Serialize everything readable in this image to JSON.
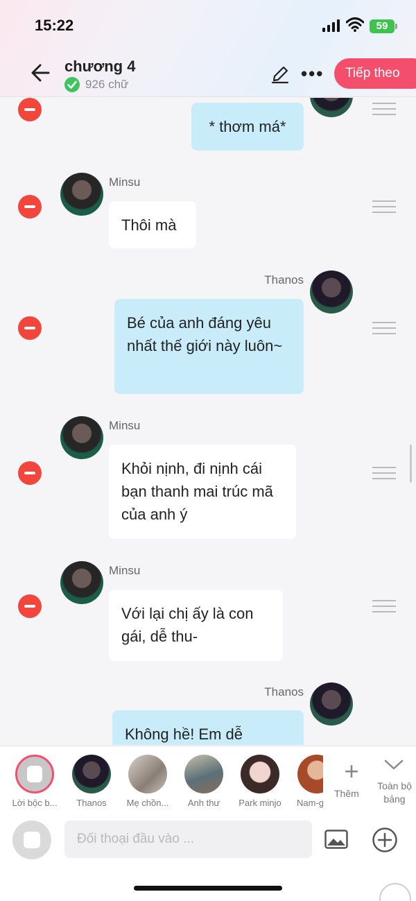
{
  "status": {
    "time": "15:22",
    "battery": "59"
  },
  "header": {
    "title": "chương 4",
    "word_count": "926 chữ",
    "next_label": "Tiếp theo"
  },
  "messages": [
    {
      "side": "right",
      "sender": "",
      "text": "* thơm má*"
    },
    {
      "side": "left",
      "sender": "Minsu",
      "text": "Thôi mà"
    },
    {
      "side": "right",
      "sender": "Thanos",
      "text": "Bé của anh đáng yêu nhất thế giới này luôn~"
    },
    {
      "side": "left",
      "sender": "Minsu",
      "text": "Khỏi nịnh, đi nịnh cái bạn thanh mai trúc mã của anh ý"
    },
    {
      "side": "left",
      "sender": "Minsu",
      "text": "Với lại chị ấy là con gái, dễ thu-"
    },
    {
      "side": "right",
      "sender": "Thanos",
      "text": "Không hề! Em dễ"
    }
  ],
  "characters": [
    {
      "label": "Lời bộc b..."
    },
    {
      "label": "Thanos"
    },
    {
      "label": "Mẹ chồn..."
    },
    {
      "label": "Anh thư"
    },
    {
      "label": "Park minjo"
    },
    {
      "label": "Nam-gi"
    }
  ],
  "strip": {
    "add_label": "Thêm",
    "all_label": "Toàn bộ bảng"
  },
  "input": {
    "placeholder": "Đối thoại đầu vào ..."
  },
  "colors": {
    "accent": "#f34f6d",
    "bubble_right": "#c9ecfb",
    "bubble_left": "#ffffff",
    "delete": "#f2453c"
  }
}
